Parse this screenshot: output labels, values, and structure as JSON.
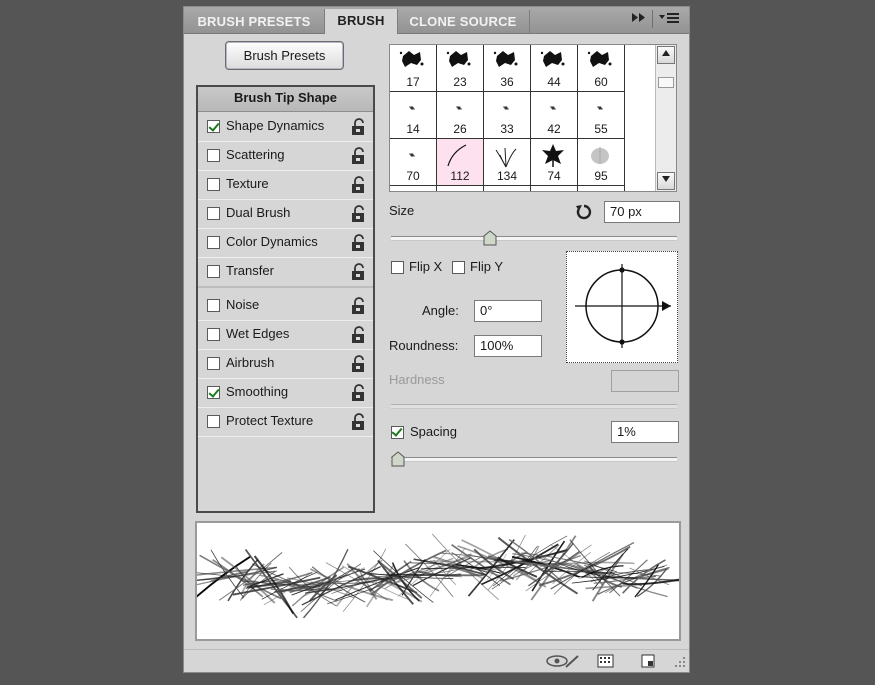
{
  "tabs": [
    {
      "label": "BRUSH PRESETS",
      "active": false
    },
    {
      "label": "BRUSH",
      "active": true
    },
    {
      "label": "CLONE SOURCE",
      "active": false
    }
  ],
  "panel_menu": {
    "collapse_glyph": "▸▸",
    "menu_glyph": "▾≡"
  },
  "presets_button": "Brush Presets",
  "options": {
    "header": "Brush Tip Shape",
    "group1": [
      {
        "label": "Shape Dynamics",
        "checked": true
      },
      {
        "label": "Scattering",
        "checked": false
      },
      {
        "label": "Texture",
        "checked": false
      },
      {
        "label": "Dual Brush",
        "checked": false
      },
      {
        "label": "Color Dynamics",
        "checked": false
      },
      {
        "label": "Transfer",
        "checked": false
      }
    ],
    "group2": [
      {
        "label": "Noise",
        "checked": false
      },
      {
        "label": "Wet Edges",
        "checked": false
      },
      {
        "label": "Airbrush",
        "checked": false
      },
      {
        "label": "Smoothing",
        "checked": true
      },
      {
        "label": "Protect Texture",
        "checked": false
      }
    ]
  },
  "preset_grid": {
    "selected": "112",
    "rows": [
      [
        "17",
        "23",
        "36",
        "44",
        "60"
      ],
      [
        "14",
        "26",
        "33",
        "42",
        "55"
      ],
      [
        "70",
        "112",
        "134",
        "74",
        "95"
      ]
    ]
  },
  "size": {
    "label": "Size",
    "value": "70 px",
    "slider_fraction": 0.34
  },
  "flip": {
    "x_label": "Flip X",
    "y_label": "Flip Y",
    "x_checked": false,
    "y_checked": false
  },
  "angle": {
    "label": "Angle:",
    "value": "0°"
  },
  "roundness": {
    "label": "Roundness:",
    "value": "100%"
  },
  "hardness": {
    "label": "Hardness",
    "value": ""
  },
  "spacing": {
    "label": "Spacing",
    "value": "1%",
    "checked": true,
    "slider_fraction": 0.0
  },
  "icons": {
    "reset": "reset-icon",
    "lock": "lock-icon",
    "eye_brush": "eye-brush-icon",
    "grid_toggle": "grid-icon",
    "new_preset": "new-preset-icon"
  },
  "colors": {
    "panel": "#d6d6d6",
    "selected_cell": "#fde1ee",
    "check": "#1d7a1d"
  }
}
